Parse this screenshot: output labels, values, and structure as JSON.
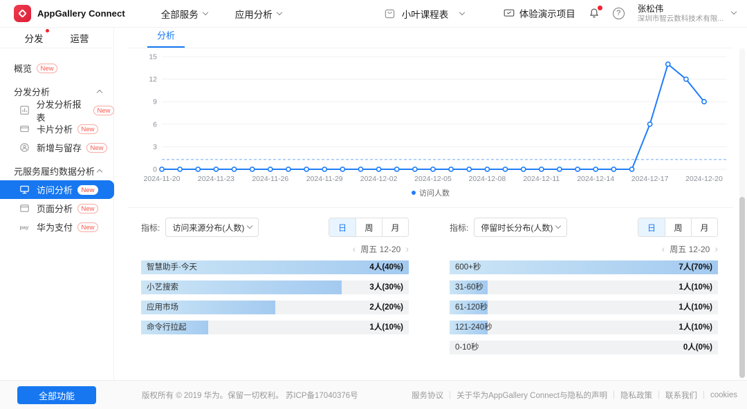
{
  "header": {
    "brand": "AppGallery Connect",
    "nav": [
      {
        "label": "全部服务"
      },
      {
        "label": "应用分析"
      }
    ],
    "app_selector": "小叶课程表",
    "project_label": "体验演示项目",
    "help_glyph": "?",
    "user": {
      "name": "张松伟",
      "org": "深圳市智云数科技术有限..."
    }
  },
  "sidebar": {
    "tabs": [
      {
        "label": "分发",
        "dot": true
      },
      {
        "label": "运营",
        "dot": false
      }
    ],
    "items": [
      {
        "type": "link",
        "label": "概览",
        "badge": "New"
      },
      {
        "type": "group",
        "label": "分发分析"
      },
      {
        "type": "link",
        "icon": "report-icon",
        "label": "分发分析报表",
        "badge": "New"
      },
      {
        "type": "link",
        "icon": "card-icon",
        "label": "卡片分析",
        "badge": "New"
      },
      {
        "type": "link",
        "icon": "users-icon",
        "label": "新增与留存",
        "badge": "New"
      },
      {
        "type": "group",
        "label": "元服务履约数据分析"
      },
      {
        "type": "link",
        "icon": "monitor-icon",
        "label": "访问分析",
        "badge": "New",
        "selected": true
      },
      {
        "type": "link",
        "icon": "page-icon",
        "label": "页面分析",
        "badge": "New"
      },
      {
        "type": "link",
        "icon": "pay-icon",
        "label": "华为支付",
        "badge": "New"
      }
    ],
    "all_features_button": "全部功能"
  },
  "main": {
    "tab": "分析"
  },
  "chart_data": [
    {
      "type": "line",
      "x": [
        "2024-11-20",
        "2024-11-21",
        "2024-11-22",
        "2024-11-23",
        "2024-11-24",
        "2024-11-25",
        "2024-11-26",
        "2024-11-27",
        "2024-11-28",
        "2024-11-29",
        "2024-11-30",
        "2024-12-01",
        "2024-12-02",
        "2024-12-03",
        "2024-12-04",
        "2024-12-05",
        "2024-12-06",
        "2024-12-07",
        "2024-12-08",
        "2024-12-09",
        "2024-12-10",
        "2024-12-11",
        "2024-12-12",
        "2024-12-13",
        "2024-12-14",
        "2024-12-15",
        "2024-12-16",
        "2024-12-17",
        "2024-12-18",
        "2024-12-19",
        "2024-12-20"
      ],
      "x_tick_labels": [
        "2024-11-20",
        "2024-11-23",
        "2024-11-26",
        "2024-11-29",
        "2024-12-02",
        "2024-12-05",
        "2024-12-08",
        "2024-12-11",
        "2024-12-14",
        "2024-12-17",
        "2024-12-20"
      ],
      "series": [
        {
          "name": "访问人数",
          "values": [
            0,
            0,
            0,
            0,
            0,
            0,
            0,
            0,
            0,
            0,
            0,
            0,
            0,
            0,
            0,
            0,
            0,
            0,
            0,
            0,
            0,
            0,
            0,
            0,
            0,
            0,
            0,
            6,
            14,
            12,
            9
          ]
        }
      ],
      "ylim": [
        0,
        15
      ],
      "yticks": [
        0,
        3,
        6,
        9,
        12,
        15
      ],
      "average_line": 1.3,
      "grid": true,
      "legend_position": "bottom",
      "line_color": "#1f7df8"
    },
    {
      "type": "bar",
      "title": "访问来源分布(人数)",
      "orientation": "horizontal",
      "categories": [
        "智慧助手·今天",
        "小艺搜索",
        "应用市场",
        "命令行拉起"
      ],
      "values": [
        4,
        3,
        2,
        1
      ],
      "percentages": [
        40,
        30,
        20,
        10
      ],
      "display_values": [
        "4人(40%)",
        "3人(30%)",
        "2人(20%)",
        "1人(10%)"
      ],
      "bar_width_pct": [
        100,
        75,
        50,
        25
      ]
    },
    {
      "type": "bar",
      "title": "停留时长分布(人数)",
      "orientation": "horizontal",
      "categories": [
        "600+秒",
        "31-60秒",
        "61-120秒",
        "121-240秒",
        "0-10秒"
      ],
      "values": [
        7,
        1,
        1,
        1,
        0
      ],
      "percentages": [
        70,
        10,
        10,
        10,
        0
      ],
      "display_values": [
        "7人(70%)",
        "1人(10%)",
        "1人(10%)",
        "1人(10%)",
        "0人(0%)"
      ],
      "bar_width_pct": [
        100,
        14.3,
        14.3,
        14.3,
        0
      ]
    }
  ],
  "sections": [
    {
      "metric_label": "指标:",
      "dropdown_value": "访问来源分布(人数)",
      "period_options": [
        "日",
        "周",
        "月"
      ],
      "selected_period": "日",
      "date_nav": "周五 12-20"
    },
    {
      "metric_label": "指标:",
      "dropdown_value": "停留时长分布(人数)",
      "period_options": [
        "日",
        "周",
        "月"
      ],
      "selected_period": "日",
      "date_nav": "周五 12-20"
    }
  ],
  "footer": {
    "copyright": "版权所有 © 2019 华为。保留一切权利。 苏ICP备17040376号",
    "links": [
      "服务协议",
      "关于华为AppGallery Connect与隐私的声明",
      "隐私政策",
      "联系我们",
      "cookies"
    ]
  }
}
